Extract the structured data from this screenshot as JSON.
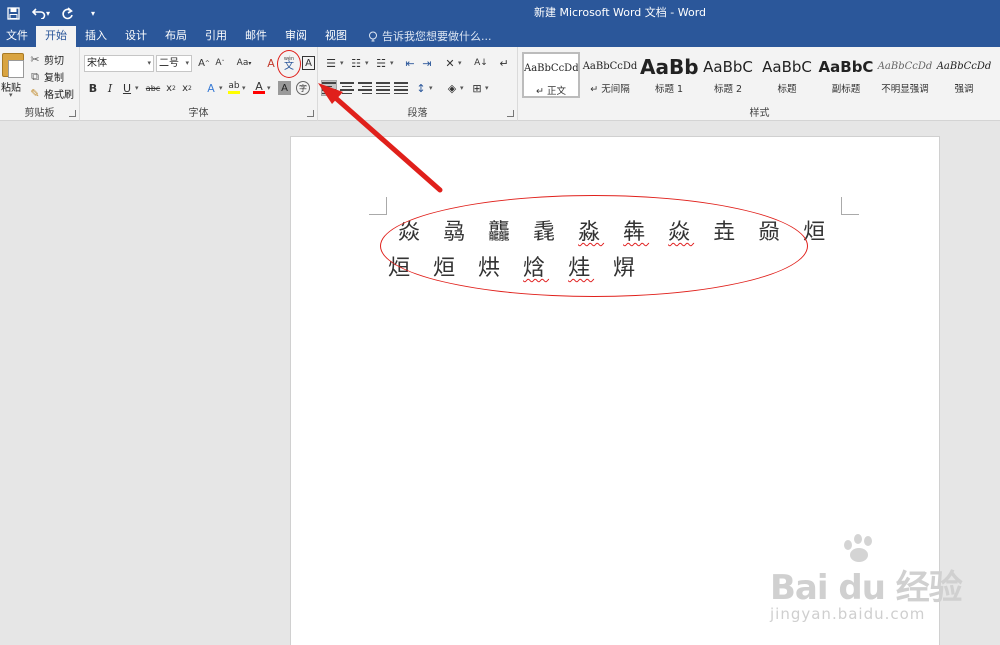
{
  "title_bar": {
    "doc_title": "新建 Microsoft Word 文档 - Word"
  },
  "tabs": [
    "文件",
    "开始",
    "插入",
    "设计",
    "布局",
    "引用",
    "邮件",
    "审阅",
    "视图"
  ],
  "active_tab": "开始",
  "tell_me": "告诉我您想要做什么...",
  "clipboard": {
    "paste": "粘贴",
    "cut": "剪切",
    "copy": "复制",
    "format_painter": "格式刷",
    "group_label": "剪贴板"
  },
  "font_group": {
    "font_name": "宋体",
    "font_size": "二号",
    "group_label": "字体",
    "highlight_color": "#ffff00",
    "font_color": "#ff0000"
  },
  "paragraph_group": {
    "group_label": "段落"
  },
  "styles_group": {
    "group_label": "样式",
    "items": [
      {
        "preview": "AaBbCcDd",
        "name": "↵ 正文"
      },
      {
        "preview": "AaBbCcDd",
        "name": "↵ 无间隔"
      },
      {
        "preview": "AaBb",
        "name": "标题 1"
      },
      {
        "preview": "AaBbC",
        "name": "标题 2"
      },
      {
        "preview": "AaBbC",
        "name": "标题"
      },
      {
        "preview": "AaBbC",
        "name": "副标题"
      },
      {
        "preview": "AaBbCcDd",
        "name": "不明显强调"
      },
      {
        "preview": "AaBbCcDd",
        "name": "强调"
      }
    ]
  },
  "document": {
    "line1": "焱 骉 龘 毳 淼 犇 焱 垚 赑 烜",
    "line2": "烜 烜  烘 焓 烓 焺"
  },
  "annotation_color": "#e0201b",
  "watermark": {
    "logo": "Bai du 经验",
    "sub": "jingyan.baidu.com"
  }
}
